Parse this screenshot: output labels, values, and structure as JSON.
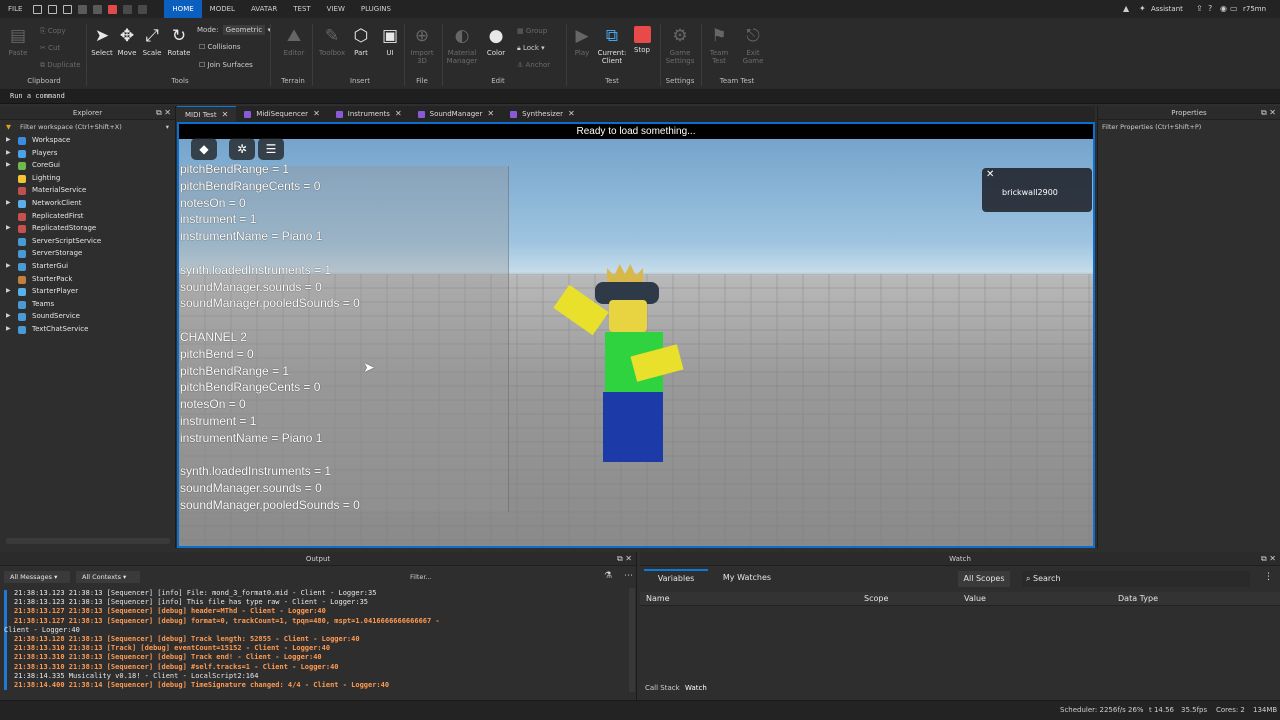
{
  "menu": {
    "file": "FILE",
    "tabs": [
      "HOME",
      "MODEL",
      "AVATAR",
      "TEST",
      "VIEW",
      "PLUGINS"
    ],
    "active_tab": "HOME",
    "assistant": "Assistant",
    "user": "r75mn"
  },
  "ribbon": {
    "clipboard": {
      "paste": "Paste",
      "copy": "Copy",
      "cut": "Cut",
      "duplicate": "Duplicate",
      "label": "Clipboard"
    },
    "tools": {
      "select": "Select",
      "move": "Move",
      "scale": "Scale",
      "rotate": "Rotate",
      "mode_label": "Mode:",
      "mode_value": "Geometric",
      "collisions": "Collisions",
      "join_surfaces": "Join Surfaces",
      "label": "Tools"
    },
    "terrain": {
      "editor": "Editor",
      "label": "Terrain"
    },
    "insert": {
      "toolbox": "Toolbox",
      "part": "Part",
      "ui": "UI",
      "label": "Insert"
    },
    "file": {
      "import": "Import 3D",
      "label": "File"
    },
    "edit": {
      "material_manager": "Material Manager",
      "color": "Color",
      "group": "Group",
      "lock": "Lock",
      "anchor": "Anchor",
      "label": "Edit"
    },
    "test": {
      "play": "Play",
      "current_client": "Current: Client",
      "stop": "Stop",
      "label": "Test"
    },
    "settings": {
      "game_settings": "Game Settings",
      "label": "Settings"
    },
    "team_test": {
      "team_test": "Team Test",
      "exit_game": "Exit Game",
      "label": "Team Test"
    }
  },
  "command_bar": {
    "placeholder": "Run a command"
  },
  "explorer": {
    "title": "Explorer",
    "filter": "Filter workspace (Ctrl+Shift+X)",
    "items": [
      {
        "label": "Workspace",
        "icon_color": "#3a8de0",
        "expandable": true
      },
      {
        "label": "Players",
        "icon_color": "#4aa3e8",
        "expandable": true
      },
      {
        "label": "CoreGui",
        "icon_color": "#6dbb4a",
        "expandable": true
      },
      {
        "label": "Lighting",
        "icon_color": "#f2c531",
        "expandable": false
      },
      {
        "label": "MaterialService",
        "icon_color": "#c0504d",
        "expandable": false
      },
      {
        "label": "NetworkClient",
        "icon_color": "#5ab0e8",
        "expandable": true
      },
      {
        "label": "ReplicatedFirst",
        "icon_color": "#c85050",
        "expandable": false
      },
      {
        "label": "ReplicatedStorage",
        "icon_color": "#c85050",
        "expandable": true
      },
      {
        "label": "ServerScriptService",
        "icon_color": "#4a9ad8",
        "expandable": false
      },
      {
        "label": "ServerStorage",
        "icon_color": "#4a9ad8",
        "expandable": false
      },
      {
        "label": "StarterGui",
        "icon_color": "#4a9ad8",
        "expandable": true
      },
      {
        "label": "StarterPack",
        "icon_color": "#c08040",
        "expandable": false
      },
      {
        "label": "StarterPlayer",
        "icon_color": "#5ab0e8",
        "expandable": true
      },
      {
        "label": "Teams",
        "icon_color": "#4a9ad8",
        "expandable": false
      },
      {
        "label": "SoundService",
        "icon_color": "#4a9ad8",
        "expandable": true
      },
      {
        "label": "TextChatService",
        "icon_color": "#4a9ad8",
        "expandable": true
      }
    ]
  },
  "doc_tabs": [
    {
      "label": "MIDI Test",
      "active": true
    },
    {
      "label": "MidiSequencer",
      "active": false
    },
    {
      "label": "Instruments",
      "active": false
    },
    {
      "label": "SoundManager",
      "active": false
    },
    {
      "label": "Synthesizer",
      "active": false
    }
  ],
  "viewport": {
    "status": "Ready to load something...",
    "overlay_lines": [
      "pitchBendRange = 1",
      "pitchBendRangeCents = 0",
      "notesOn = 0",
      "instrument = 1",
      "instrumentName = Piano 1",
      "",
      "synth.loadedInstruments = 1",
      "soundManager.sounds = 0",
      "soundManager.pooledSounds = 0",
      "",
      "CHANNEL 2",
      "pitchBend = 0",
      "pitchBendRange = 1",
      "pitchBendRangeCents = 0",
      "notesOn = 0",
      "instrument = 1",
      "instrumentName = Piano 1",
      "",
      "synth.loadedInstruments = 1",
      "soundManager.sounds = 0",
      "soundManager.pooledSounds = 0"
    ],
    "toast_user": "brickwall2900"
  },
  "properties": {
    "title": "Properties",
    "filter": "Filter Properties (Ctrl+Shift+P)"
  },
  "output": {
    "title": "Output",
    "all_messages": "All Messages",
    "all_contexts": "All Contexts",
    "filter": "Filter...",
    "lines": [
      {
        "kind": "info",
        "text": "21:38:13.123  21:38:13 [Sequencer] [info] File: mond_3_format0.mid  -  Client - Logger:35"
      },
      {
        "kind": "info",
        "text": "21:38:13.123  21:38:13 [Sequencer] [info] This file has type raw  -  Client - Logger:35"
      },
      {
        "kind": "debug",
        "text": "21:38:13.127  21:38:13 [Sequencer] [debug] header=MThd  -  Client - Logger:40"
      },
      {
        "kind": "debug",
        "text": "21:38:13.127  21:38:13 [Sequencer] [debug] format=0, trackCount=1, tpqn=480, mspt=1.0416666666666667  -"
      },
      {
        "kind": "plain",
        "text": "Client - Logger:40"
      },
      {
        "kind": "debug",
        "text": "21:38:13.128  21:38:13 [Sequencer] [debug] Track length: 52855  -  Client - Logger:40"
      },
      {
        "kind": "debug",
        "text": "21:38:13.310  21:38:13 [Track] [debug] eventCount=15152  -  Client - Logger:40"
      },
      {
        "kind": "debug",
        "text": "21:38:13.310  21:38:13 [Sequencer] [debug] Track end!  -  Client - Logger:40"
      },
      {
        "kind": "debug",
        "text": "21:38:13.310  21:38:13 [Sequencer] [debug] #self.tracks=1  -  Client - Logger:40"
      },
      {
        "kind": "plain",
        "text": "21:38:14.335  Musicality v0.18!  -  Client - LocalScript2:164"
      },
      {
        "kind": "debug",
        "text": "21:38:14.400  21:38:14 [Sequencer] [debug] TimeSignature changed: 4/4  -  Client - Logger:40"
      }
    ]
  },
  "watch": {
    "title": "Watch",
    "tabs": [
      "Variables",
      "My Watches"
    ],
    "scope": "All Scopes",
    "search": "Search",
    "columns": [
      "Name",
      "Scope",
      "Value",
      "Data Type"
    ],
    "bottom_tabs": [
      "Call Stack",
      "Watch"
    ]
  },
  "statusbar": {
    "scheduler": "Scheduler: 2256f/s 26%",
    "t": "t 14.56",
    "fps": "35.5fps",
    "cores": "Cores: 2",
    "mem": "134MB"
  }
}
